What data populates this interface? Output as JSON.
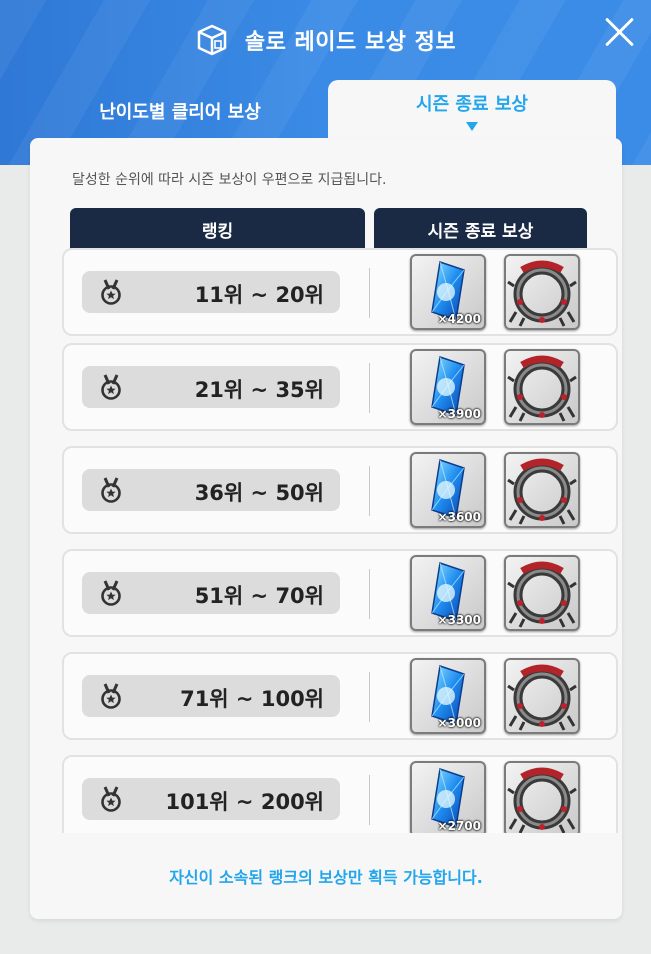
{
  "window": {
    "title": "솔로 레이드 보상 정보"
  },
  "tabs": [
    {
      "label": "난이도별 클리어 보상",
      "active": false
    },
    {
      "label": "시즌 종료 보상",
      "active": true
    }
  ],
  "panel": {
    "description": "달성한 순위에 따라 시즌 보상이 우편으로 지급됩니다.",
    "columns": {
      "rank": "랭킹",
      "reward": "시즌 종료 보상"
    },
    "rows": [
      {
        "rank": "11위 ~ 20위",
        "crystal_qty": "×4200",
        "reward_icon": "crystal-icon",
        "ring_icon": "ring-frame-icon"
      },
      {
        "rank": "21위 ~ 35위",
        "crystal_qty": "×3900",
        "reward_icon": "crystal-icon",
        "ring_icon": "ring-frame-icon"
      },
      {
        "rank": "36위 ~ 50위",
        "crystal_qty": "×3600",
        "reward_icon": "crystal-icon",
        "ring_icon": "ring-frame-icon"
      },
      {
        "rank": "51위 ~ 70위",
        "crystal_qty": "×3300",
        "reward_icon": "crystal-icon",
        "ring_icon": "ring-frame-icon"
      },
      {
        "rank": "71위 ~ 100위",
        "crystal_qty": "×3000",
        "reward_icon": "crystal-icon",
        "ring_icon": "ring-frame-icon"
      },
      {
        "rank": "101위 ~ 200위",
        "crystal_qty": "×2700",
        "reward_icon": "crystal-icon",
        "ring_icon": "ring-frame-icon"
      }
    ],
    "footer_note": "자신이 소속된 랭크의 보상만 획득 가능합니다."
  },
  "colors": {
    "header_blue": "#3a8be6",
    "accent_cyan": "#23a6ec",
    "column_header_navy": "#1b2a44"
  },
  "icons": {
    "title": "box-icon",
    "close": "close-icon",
    "medal": "medal-icon"
  }
}
